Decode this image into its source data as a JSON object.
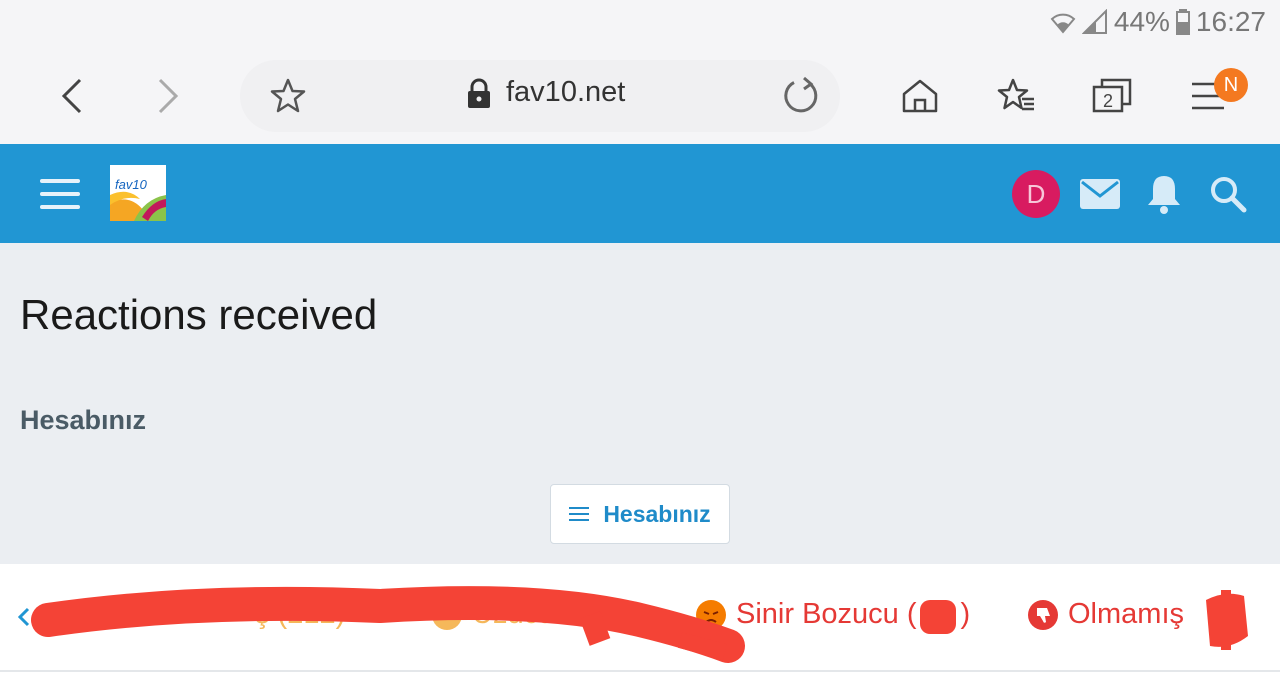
{
  "status_bar": {
    "battery": "44%",
    "time": "16:27"
  },
  "browser": {
    "url": "fav10.net",
    "tab_count": "2",
    "menu_badge": "N"
  },
  "site_header": {
    "logo_text": "fav10",
    "avatar_letter": "D"
  },
  "content": {
    "page_title": "Reactions received",
    "breadcrumb": "Hesabınız",
    "menu_button_label": "Hesabınız"
  },
  "reaction_tabs": {
    "tab1": "(36)",
    "tab2": "ş (212)",
    "tab3": "Üzücü",
    "tab4": "Sinir Bozucu (",
    "tab4_close": ")",
    "tab5": "Olmamış"
  },
  "colors": {
    "header": "#2196d3",
    "accent": "#1f8bc9",
    "avatar": "#d81b60",
    "badge": "#f47920",
    "red": "#e53935"
  }
}
